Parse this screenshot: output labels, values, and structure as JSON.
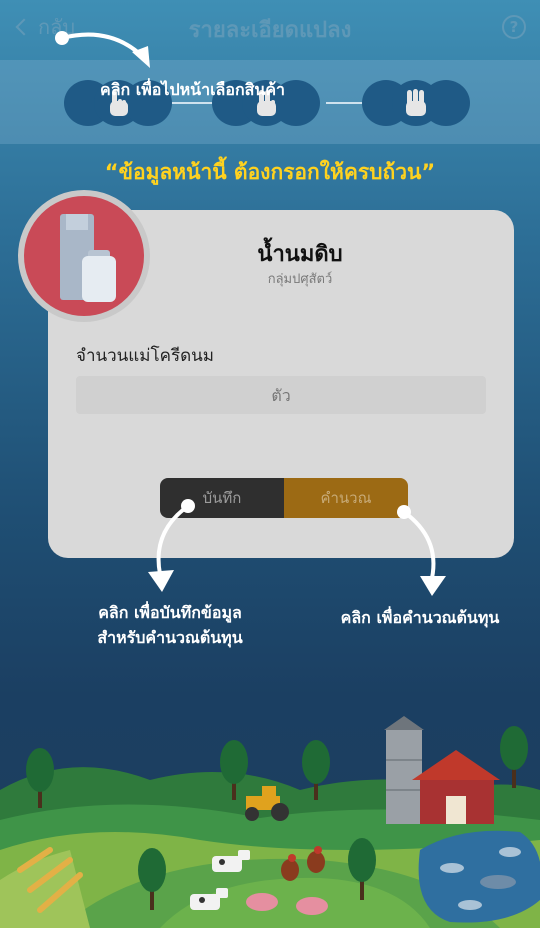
{
  "header": {
    "back_label": "กลับ",
    "title": "รายละเอียดแปลง",
    "help_label": "?"
  },
  "steps": {
    "hint": "คลิก  เพื่อไปหน้าเลือกสินค้า",
    "items": [
      "step-1",
      "step-2",
      "step-3"
    ]
  },
  "notice": "“ข้อมูลหน้านี้ ต้องกรอกให้ครบถ้วน”",
  "product": {
    "name": "น้ำนมดิบ",
    "group": "กลุ่มปศุสัตว์"
  },
  "form": {
    "label": "จำนวนแม่โครีดนม",
    "placeholder": "ตัว",
    "value": ""
  },
  "buttons": {
    "save_label": "บันทึก",
    "calc_label": "คำนวณ"
  },
  "hints": {
    "save_line1": "คลิก  เพื่อบันทึกข้อมูล",
    "save_line2": "สำหรับคำนวณต้นทุน",
    "calc": "คลิก  เพื่อคำนวณต้นทุน"
  },
  "colors": {
    "notice": "#ffd21f",
    "save_button": "#2f2f2f",
    "calc_button": "#9c6a14",
    "product_circle": "#c94a57"
  },
  "icons": {
    "back": "chevron-left-icon",
    "help": "help-icon",
    "step1": "hand-one-finger-icon",
    "step2": "hand-two-fingers-icon",
    "step3": "hand-three-fingers-icon",
    "product": "milk-icon"
  }
}
